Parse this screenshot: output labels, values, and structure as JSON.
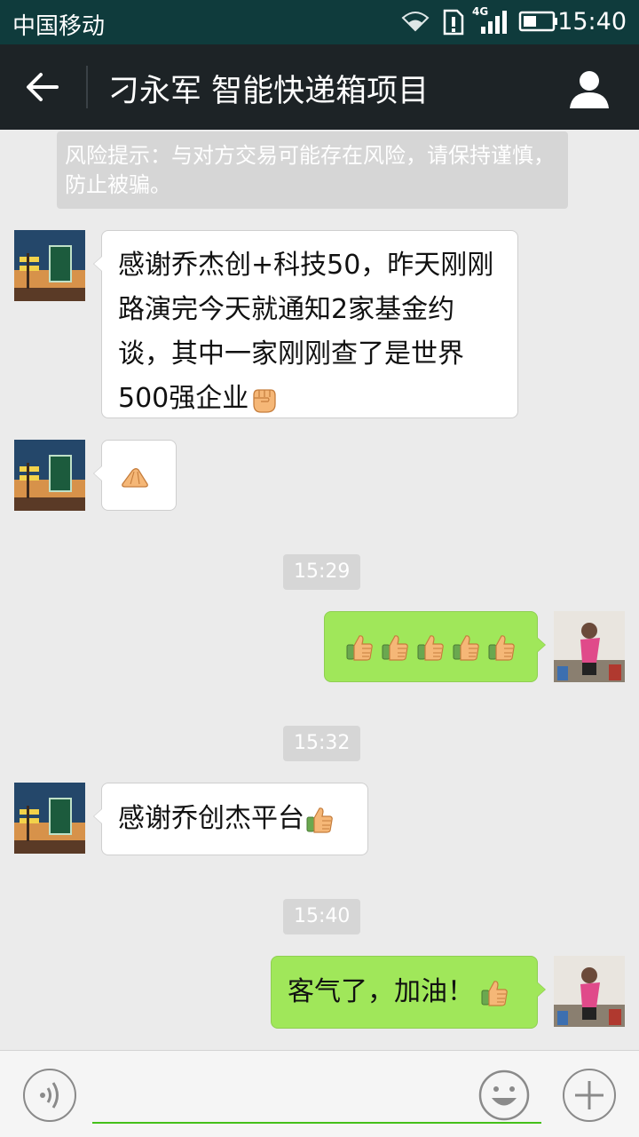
{
  "status_bar": {
    "carrier": "中国移动",
    "network": "4G",
    "time": "15:40"
  },
  "header": {
    "title": "刁永军 智能快递箱项目",
    "back_icon": "back-arrow-icon",
    "contact_icon": "person-icon"
  },
  "notice": {
    "text": "风险提示：与对方交易可能存在风险，请保持谨慎，防止被骗。"
  },
  "messages": [
    {
      "side": "in",
      "text": "感谢乔杰创+科技50，昨天刚刚路演完今天就通知2家基金约谈，其中一家刚刚查了是世界500强企业",
      "emoji": [
        "fist-emoji"
      ]
    },
    {
      "side": "in",
      "text": "",
      "emoji": [
        "ok-hand-emoji"
      ]
    },
    {
      "side": "out",
      "text": "",
      "emoji": [
        "thumbs-up-emoji",
        "thumbs-up-emoji",
        "thumbs-up-emoji",
        "thumbs-up-emoji",
        "thumbs-up-emoji"
      ]
    },
    {
      "side": "in",
      "text": "感谢乔创杰平台",
      "emoji": [
        "thumbs-up-emoji"
      ]
    },
    {
      "side": "out",
      "text": "客气了，加油！",
      "emoji": [
        "thumbs-up-emoji"
      ]
    }
  ],
  "timestamps": [
    "15:29",
    "15:32",
    "15:40"
  ],
  "input_bar": {
    "value": "",
    "voice_icon": "voice-icon",
    "emoji_icon": "smiley-icon",
    "plus_icon": "plus-icon"
  },
  "colors": {
    "status_bar": "#0f3b3c",
    "title_bar": "#1d2326",
    "outgoing_bubble": "#a0e75a",
    "incoming_bubble": "#ffffff",
    "accent": "#45c01a"
  }
}
